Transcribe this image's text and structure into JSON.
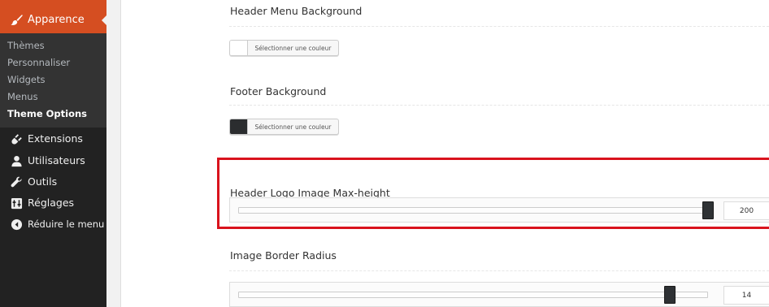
{
  "sidebar": {
    "active_menu": {
      "label": "Apparence",
      "icon": "paintbrush-icon"
    },
    "submenu": [
      {
        "label": "Thèmes",
        "current": false
      },
      {
        "label": "Personnaliser",
        "current": false
      },
      {
        "label": "Widgets",
        "current": false
      },
      {
        "label": "Menus",
        "current": false
      },
      {
        "label": "Theme Options",
        "current": true
      }
    ],
    "items": [
      {
        "label": "Extensions",
        "icon": "plugin-icon"
      },
      {
        "label": "Utilisateurs",
        "icon": "user-icon"
      },
      {
        "label": "Outils",
        "icon": "wrench-icon"
      },
      {
        "label": "Réglages",
        "icon": "settings-icon"
      },
      {
        "label": "Réduire le menu",
        "icon": "collapse-arrow-icon"
      }
    ]
  },
  "sections": {
    "header_menu_bg": {
      "title": "Header Menu Background",
      "button_label": "Sélectionner une couleur",
      "swatch_color": "#ffffff"
    },
    "footer_bg": {
      "title": "Footer Background",
      "button_label": "Sélectionner une couleur",
      "swatch_color": "#2b2d2f"
    },
    "logo_max_height": {
      "title": "Header Logo Image Max-height",
      "value": "200",
      "slider_fraction": 1.0
    },
    "border_radius": {
      "title": "Image Border Radius",
      "value": "14",
      "slider_fraction": 0.93
    }
  },
  "colors": {
    "sidebar_bg": "#222222",
    "submenu_bg": "#333333",
    "active_accent": "#d54e21",
    "highlight_border": "#d9131d"
  }
}
